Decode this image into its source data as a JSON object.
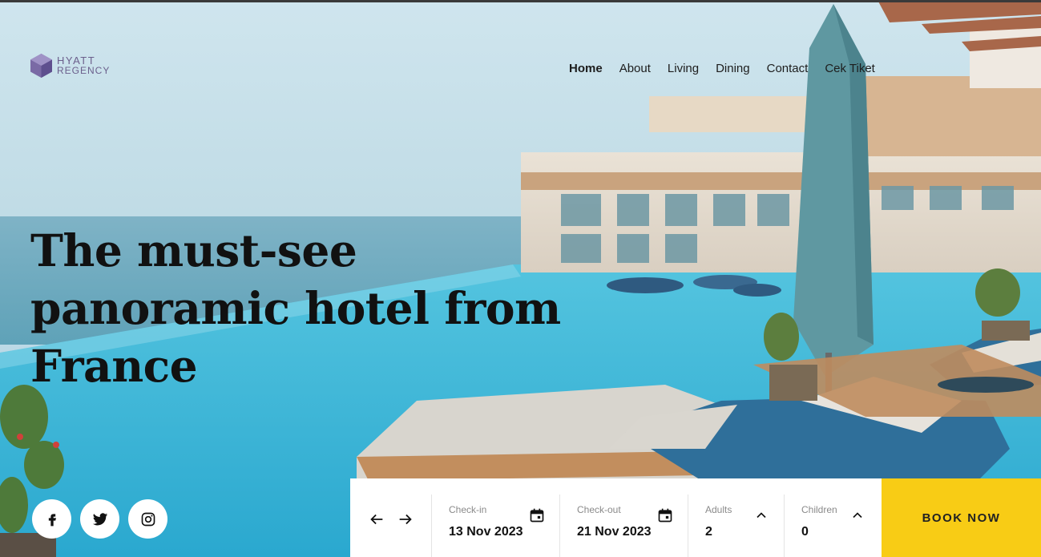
{
  "brand": {
    "line1": "HYATT",
    "line2": "REGENCY"
  },
  "nav": {
    "items": [
      {
        "label": "Home"
      },
      {
        "label": "About"
      },
      {
        "label": "Living"
      },
      {
        "label": "Dining"
      },
      {
        "label": "Contact"
      },
      {
        "label": "Cek Tiket"
      }
    ],
    "active": "Home"
  },
  "hero": {
    "title": "The must-see panoramic hotel from France"
  },
  "social": [
    "facebook-icon",
    "twitter-icon",
    "instagram-icon"
  ],
  "booking": {
    "checkin": {
      "label": "Check-in",
      "value": "13 Nov 2023"
    },
    "checkout": {
      "label": "Check-out",
      "value": "21 Nov 2023"
    },
    "adults": {
      "label": "Adults",
      "value": "2"
    },
    "children": {
      "label": "Children",
      "value": "0"
    },
    "button": "BOOK NOW"
  },
  "colors": {
    "accent": "#f8cc15",
    "brand": "#6b5f8c",
    "pool": "#3fb9d8"
  }
}
